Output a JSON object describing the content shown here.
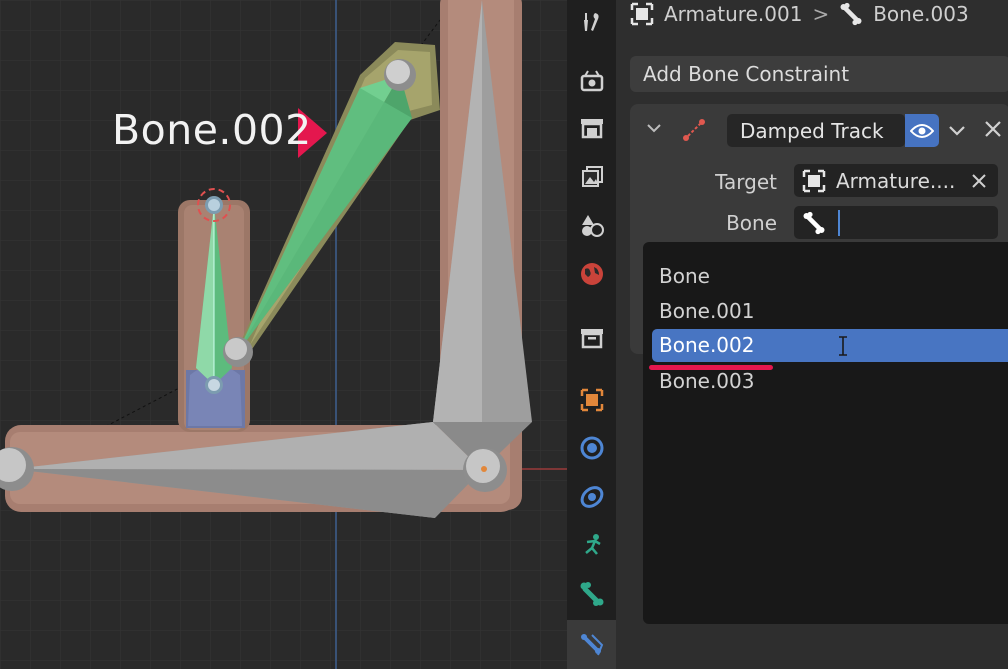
{
  "annotation": {
    "label": "Bone.002",
    "color": "#e4174e"
  },
  "header": {
    "armature_name": "Armature.001",
    "separator": ">",
    "bone_name": "Bone.003"
  },
  "properties": {
    "add_constraint_label": "Add Bone Constraint",
    "constraint": {
      "name": "Damped Track",
      "target_label": "Target",
      "target_value": "Armature....",
      "bone_label": "Bone",
      "bone_value": ""
    }
  },
  "dropdown": {
    "items": [
      "Bone",
      "Bone.001",
      "Bone.002",
      "Bone.003"
    ],
    "selected": "Bone.002"
  },
  "tabs": [
    "tool-icon",
    "render-icon",
    "output-icon",
    "view-layer-icon",
    "scene-icon",
    "world-icon",
    "collection-icon",
    "object-icon",
    "modifier-icon",
    "particles-icon",
    "physics-icon",
    "bone-icon",
    "bone-constraint-icon"
  ],
  "colors": {
    "accent": "#4673c1",
    "selected_bone": "#5dbb7d",
    "highlight": "#e4174e",
    "object_orange": "#e2873a"
  }
}
